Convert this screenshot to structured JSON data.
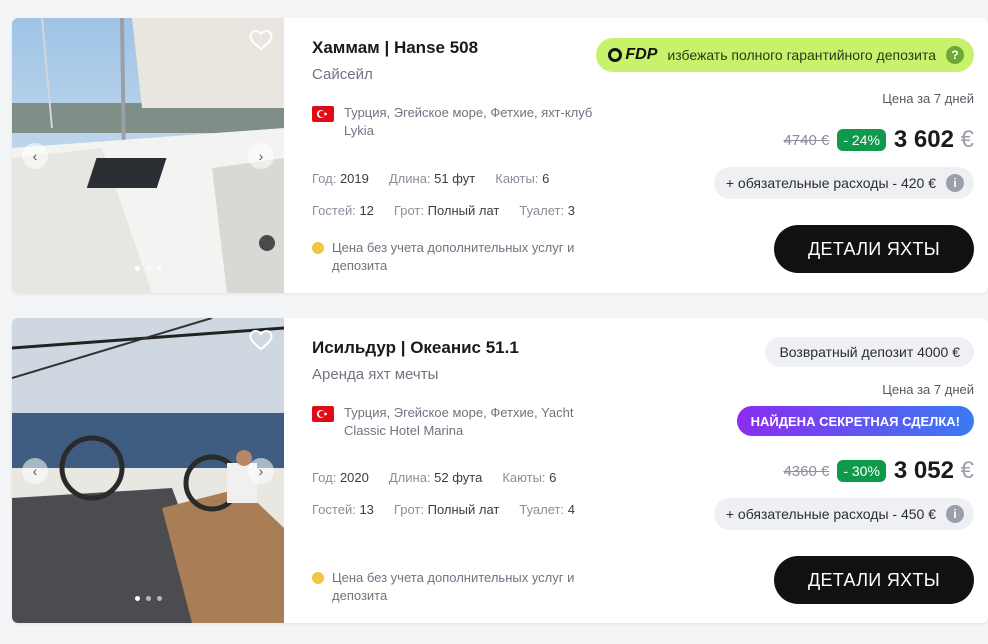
{
  "listings": [
    {
      "title": "Хаммам | Hanse 508",
      "subtitle": "Сайсейл",
      "location": "Турция, Эгейское море, Фетхие, яхт-клуб Lykia",
      "specs_row1": [
        {
          "label": "Год:",
          "value": "2019"
        },
        {
          "label": "Длина:",
          "value": "51 фут"
        },
        {
          "label": "Каюты:",
          "value": "6"
        }
      ],
      "specs_row2": [
        {
          "label": "Гостей:",
          "value": "12"
        },
        {
          "label": "Грот:",
          "value": "Полный лат"
        },
        {
          "label": "Туалет:",
          "value": "3"
        }
      ],
      "note": "Цена без учета дополнительных услуг и депозита",
      "badge": {
        "logo": "FDP",
        "text": "избежать полного гарантийного депозита",
        "help": "?"
      },
      "price_label": "Цена за 7 дней",
      "old_price": "4740 €",
      "discount": "- 24%",
      "new_price": "3 602",
      "currency": "€",
      "fees": "+ обязательные расходы - 420 €",
      "fees_info": "i",
      "button": "ДЕТАЛИ ЯХТЫ"
    },
    {
      "title": "Исильдур | Океанис 51.1",
      "subtitle": "Аренда яхт мечты",
      "location": "Турция, Эгейское море, Фетхие, Yacht Classic Hotel Marina",
      "specs_row1": [
        {
          "label": "Год:",
          "value": "2020"
        },
        {
          "label": "Длина:",
          "value": "52 фута"
        },
        {
          "label": "Каюты:",
          "value": "6"
        }
      ],
      "specs_row2": [
        {
          "label": "Гостей:",
          "value": "13"
        },
        {
          "label": "Грот:",
          "value": "Полный лат"
        },
        {
          "label": "Туалет:",
          "value": "4"
        }
      ],
      "note": "Цена без учета дополнительных услуг и депозита",
      "deposit": "Возвратный депозит 4000 €",
      "secret_deal": "НАЙДЕНА СЕКРЕТНАЯ СДЕЛКА!",
      "price_label": "Цена за 7 дней",
      "old_price": "4360 €",
      "discount": "- 30%",
      "new_price": "3 052",
      "currency": "€",
      "fees": "+ обязательные расходы - 450 €",
      "fees_info": "i",
      "button": "ДЕТАЛИ ЯХТЫ"
    }
  ],
  "icons": {
    "favorite": "heart-icon",
    "prev": "chevron-left-icon",
    "next": "chevron-right-icon",
    "flag": "turkey-flag-icon",
    "note": "info-dot-icon"
  },
  "colors": {
    "fdp_badge": "#c8f26b",
    "discount": "#0e9a4a",
    "button": "#111111",
    "secret_start": "#8c2cf0",
    "secret_end": "#3a7bf2"
  }
}
